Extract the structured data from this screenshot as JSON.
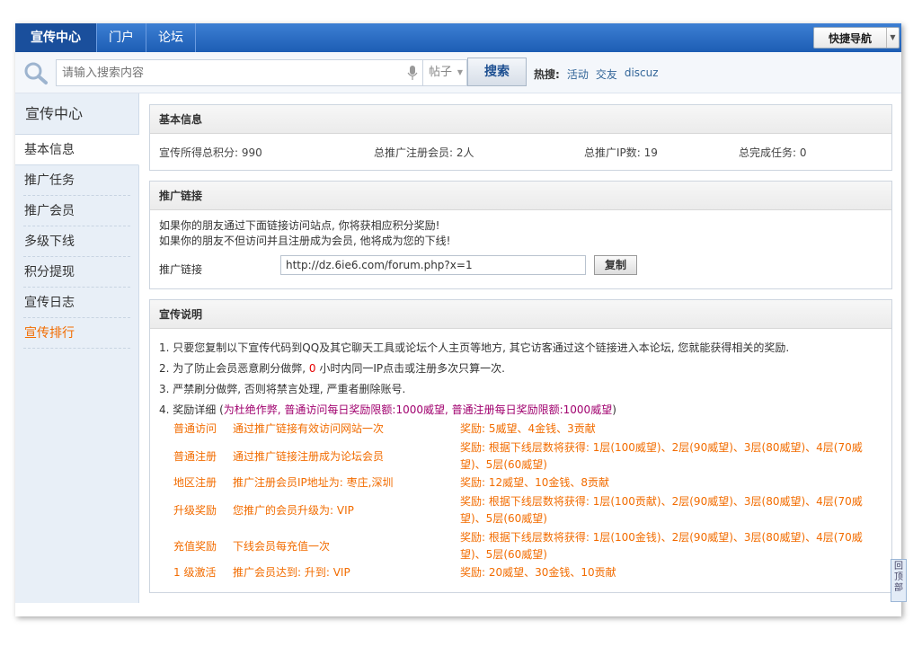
{
  "topnav": {
    "items": [
      {
        "label": "宣传中心",
        "active": true
      },
      {
        "label": "门户",
        "active": false
      },
      {
        "label": "论坛",
        "active": false
      }
    ],
    "quicknav_label": "快捷导航"
  },
  "search": {
    "placeholder": "请输入搜索内容",
    "type_label": "帖子",
    "button_label": "搜索",
    "hot_label": "热搜:",
    "hot_links": [
      "活动",
      "交友",
      "discuz"
    ]
  },
  "sidebar": {
    "title": "宣传中心",
    "items": [
      {
        "label": "基本信息",
        "state": "active"
      },
      {
        "label": "推广任务",
        "state": ""
      },
      {
        "label": "推广会员",
        "state": ""
      },
      {
        "label": "多级下线",
        "state": ""
      },
      {
        "label": "积分提现",
        "state": ""
      },
      {
        "label": "宣传日志",
        "state": ""
      },
      {
        "label": "宣传排行",
        "state": "highlight"
      }
    ]
  },
  "basic_info": {
    "title": "基本信息",
    "total_points": "宣传所得总积分: 990",
    "total_members": "总推广注册会员: 2人",
    "total_ips": "总推广IP数: 19",
    "total_tasks": "总完成任务: 0"
  },
  "promo_link": {
    "title": "推广链接",
    "desc_1": "如果你的朋友通过下面链接访问站点, 你将获相应积分奖励!",
    "desc_2": "如果你的朋友不但访问并且注册成为会员, 他将成为您的下线!",
    "label": "推广链接",
    "url": "http://dz.6ie6.com/forum.php?x=1",
    "copy_label": "复制"
  },
  "promo_desc": {
    "title": "宣传说明",
    "rule_1": "1. 只要您复制以下宣传代码到QQ及其它聊天工具或论坛个人主页等地方, 其它访客通过这个链接进入本论坛, 您就能获得相关的奖励.",
    "rule_2_pre": "2. 为了防止会员恶意刷分做弊, ",
    "rule_2_num": "0",
    "rule_2_post": " 小时内同一IP点击或注册多次只算一次.",
    "rule_3": "3. 严禁刷分做弊, 否则将禁言处理, 严重者删除账号.",
    "rule_4_pre": "4. 奖励详细 (",
    "rule_4_note": "为杜绝作弊, 普通访问每日奖励限额:1000威望, 普通注册每日奖励限额:1000威望",
    "rule_4_post": ")",
    "rewards": [
      {
        "type": "普通访问",
        "condition": "通过推广链接有效访问网站一次",
        "reward": "奖励: 5威望、4金钱、3贡献"
      },
      {
        "type": "普通注册",
        "condition": "通过推广链接注册成为论坛会员",
        "reward": "奖励: 根据下线层数将获得: 1层(100威望)、2层(90威望)、3层(80威望)、4层(70威望)、5层(60威望)"
      },
      {
        "type": "地区注册",
        "condition": "推广注册会员IP地址为: 枣庄,深圳",
        "reward": "奖励: 12威望、10金钱、8贡献"
      },
      {
        "type": "升级奖励",
        "condition": "您推广的会员升级为: VIP",
        "reward": "奖励: 根据下线层数将获得: 1层(100贡献)、2层(90威望)、3层(80威望)、4层(70威望)、5层(60威望)"
      },
      {
        "type": "充值奖励",
        "condition": "下线会员每充值一次",
        "reward": "奖励: 根据下线层数将获得: 1层(100金钱)、2层(90威望)、3层(80威望)、4层(70威望)、5层(60威望)"
      },
      {
        "type": "1 级激活",
        "condition": "推广会员达到: 升到: VIP",
        "reward": "奖励: 20威望、30金钱、10贡献"
      }
    ]
  },
  "backtop_label": "回顶部",
  "colors": {
    "nav_blue": "#1d5db4",
    "accent_orange": "#f26c00",
    "link_blue": "#336699"
  }
}
